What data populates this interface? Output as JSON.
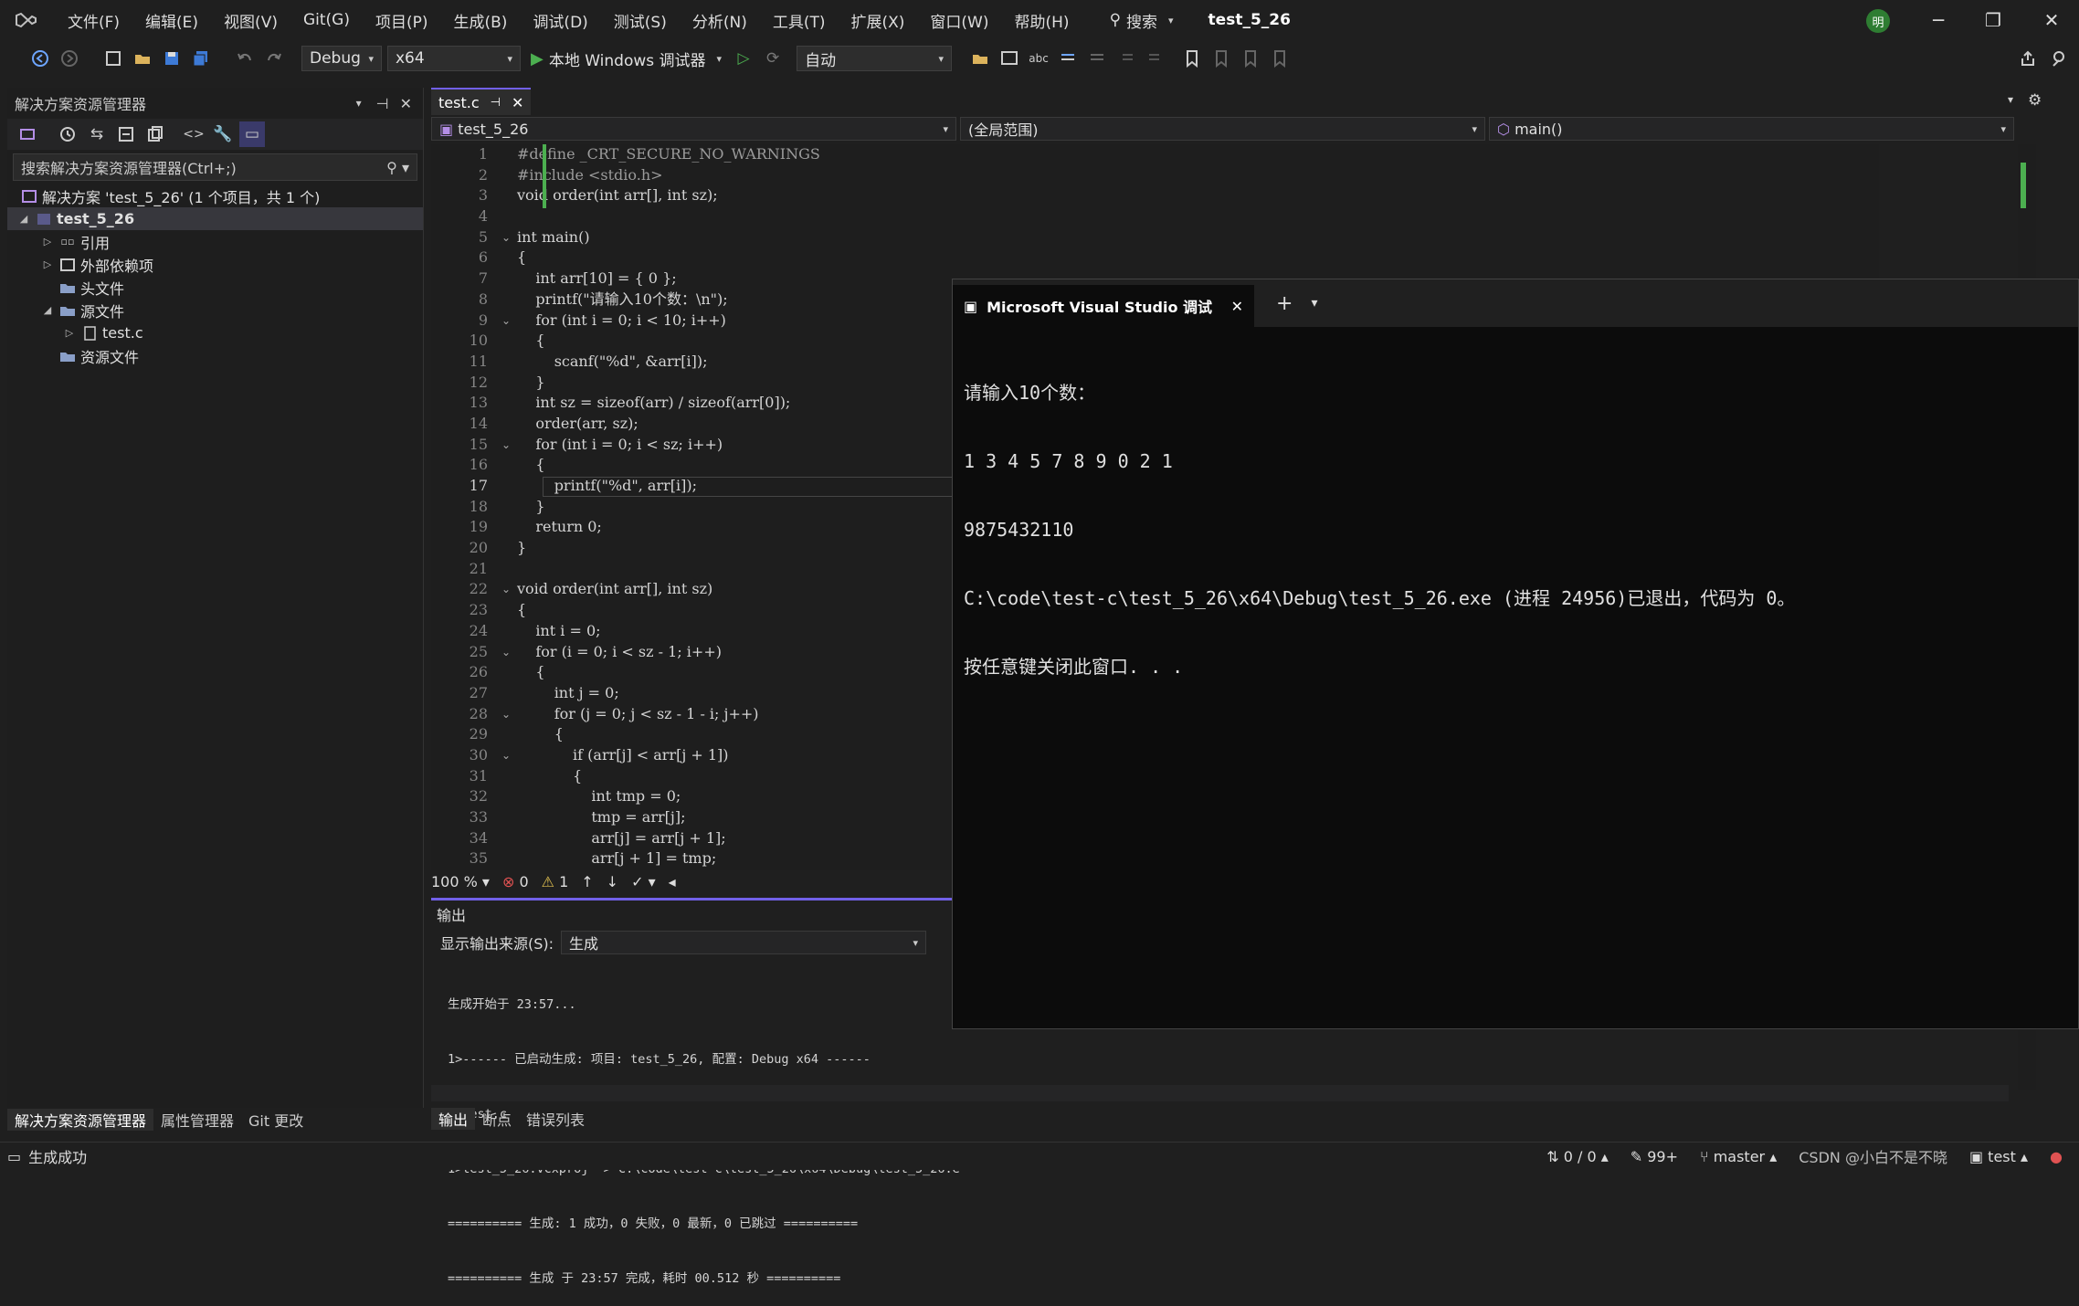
{
  "window": {
    "title": "test_5_26",
    "menu": [
      "文件(F)",
      "编辑(E)",
      "视图(V)",
      "Git(G)",
      "项目(P)",
      "生成(B)",
      "调试(D)",
      "测试(S)",
      "分析(N)",
      "工具(T)",
      "扩展(X)",
      "窗口(W)",
      "帮助(H)"
    ],
    "search_label": "搜索",
    "avatar_initial": "明"
  },
  "toolbar": {
    "config": "Debug",
    "platform": "x64",
    "run_label": "本地 Windows 调试器",
    "mode": "自动"
  },
  "solution_explorer": {
    "title": "解决方案资源管理器",
    "search_placeholder": "搜索解决方案资源管理器(Ctrl+;)",
    "items": [
      {
        "label": "解决方案 'test_5_26' (1 个项目，共 1 个)"
      },
      {
        "label": "test_5_26"
      },
      {
        "label": "引用"
      },
      {
        "label": "外部依赖项"
      },
      {
        "label": "头文件"
      },
      {
        "label": "源文件"
      },
      {
        "label": "test.c"
      },
      {
        "label": "资源文件"
      }
    ],
    "bottom_tabs": [
      "解决方案资源管理器",
      "属性管理器",
      "Git 更改"
    ]
  },
  "editor": {
    "tab_label": "test.c",
    "nav_project": "test_5_26",
    "nav_scope": "(全局范围)",
    "nav_function": "main()",
    "zoom": "100 %",
    "errors": "0",
    "warnings": "1",
    "lines": [
      "#define _CRT_SECURE_NO_WARNINGS",
      "#include <stdio.h>",
      "void order(int arr[], int sz);",
      "",
      "int main()",
      "{",
      "    int arr[10] = { 0 };",
      "    printf(\"请输入10个数：\\n\");",
      "    for (int i = 0; i < 10; i++)",
      "    {",
      "        scanf(\"%d\", &arr[i]);",
      "    }",
      "    int sz = sizeof(arr) / sizeof(arr[0]);",
      "    order(arr, sz);",
      "    for (int i = 0; i < sz; i++)",
      "    {",
      "        printf(\"%d\", arr[i]);",
      "    }",
      "    return 0;",
      "}",
      "",
      "void order(int arr[], int sz)",
      "{",
      "    int i = 0;",
      "    for (i = 0; i < sz - 1; i++)",
      "    {",
      "        int j = 0;",
      "        for (j = 0; j < sz - 1 - i; j++)",
      "        {",
      "            if (arr[j] < arr[j + 1])",
      "            {",
      "                int tmp = 0;",
      "                tmp = arr[j];",
      "                arr[j] = arr[j + 1];",
      "                arr[j + 1] = tmp;"
    ],
    "line_numbers": [
      "1",
      "2",
      "3",
      "4",
      "5",
      "6",
      "7",
      "8",
      "9",
      "10",
      "11",
      "12",
      "13",
      "14",
      "15",
      "16",
      "17",
      "18",
      "19",
      "20",
      "21",
      "22",
      "23",
      "24",
      "25",
      "26",
      "27",
      "28",
      "29",
      "30",
      "31",
      "32",
      "33",
      "34",
      "35"
    ]
  },
  "output": {
    "title": "输出",
    "source_label": "显示输出来源(S):",
    "source_value": "生成",
    "lines": [
      "生成开始于 23:57...",
      "1>------ 已启动生成: 项目: test_5_26, 配置: Debug x64 ------",
      "1>test.c",
      "1>test_5_26.vcxproj -> C:\\code\\test-c\\test_5_26\\x64\\Debug\\test_5_26.e",
      "========== 生成: 1 成功，0 失败，0 最新，0 已跳过 ==========",
      "========== 生成 于 23:57 完成，耗时 00.512 秒 =========="
    ],
    "tabs": [
      "输出",
      "断点",
      "错误列表"
    ]
  },
  "console": {
    "tab_title": "Microsoft Visual Studio 调试",
    "lines": [
      "请输入10个数：",
      "1 3 4 5 7 8 9 0 2 1",
      "9875432110",
      "C:\\code\\test-c\\test_5_26\\x64\\Debug\\test_5_26.exe (进程 24956)已退出，代码为 0。",
      "按任意键关闭此窗口. . ."
    ]
  },
  "status": {
    "left": "生成成功",
    "position": "0 / 0",
    "pending": "99+",
    "branch": "master",
    "repo": "test",
    "watermark": "CSDN @小白不是不晓"
  }
}
